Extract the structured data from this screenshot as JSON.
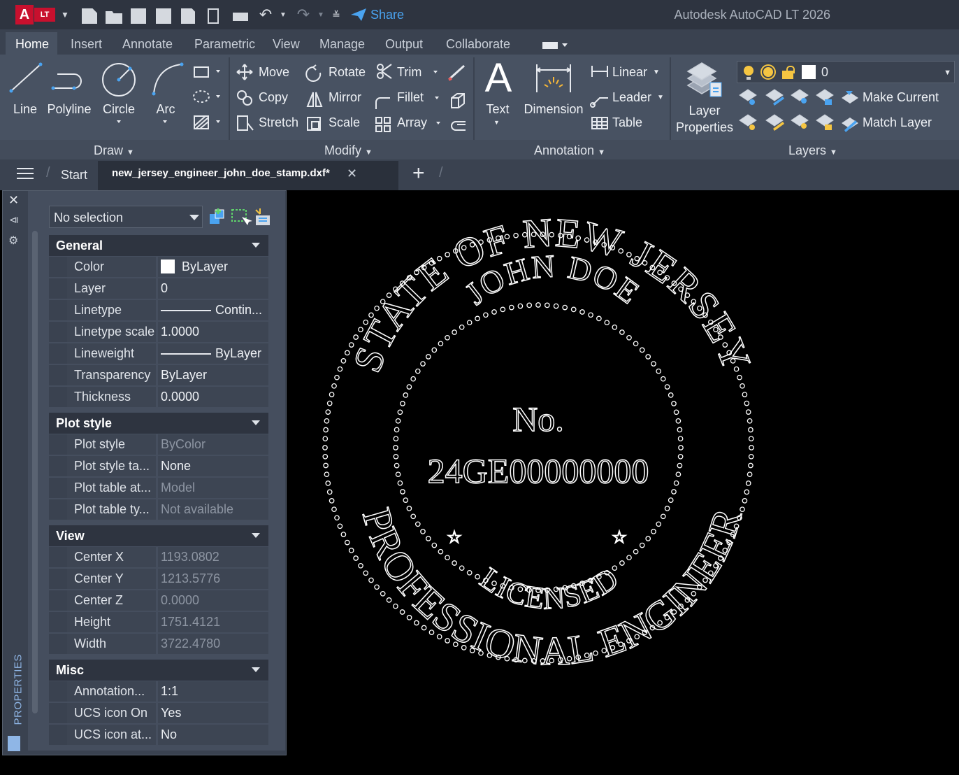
{
  "titlebar": {
    "app_title": "Autodesk AutoCAD LT 2026",
    "app_badge": "LT",
    "share_label": "Share"
  },
  "ribbon_tabs": [
    "Home",
    "Insert",
    "Annotate",
    "Parametric",
    "View",
    "Manage",
    "Output",
    "Collaborate"
  ],
  "draw": {
    "title": "Draw",
    "line": "Line",
    "polyline": "Polyline",
    "circle": "Circle",
    "arc": "Arc"
  },
  "modify": {
    "title": "Modify",
    "move": "Move",
    "rotate": "Rotate",
    "trim": "Trim",
    "copy": "Copy",
    "mirror": "Mirror",
    "fillet": "Fillet",
    "stretch": "Stretch",
    "scale": "Scale",
    "array": "Array"
  },
  "annotation": {
    "title": "Annotation",
    "text": "Text",
    "dimension": "Dimension",
    "linear": "Linear",
    "leader": "Leader",
    "table": "Table"
  },
  "layers": {
    "title": "Layers",
    "layer_properties_1": "Layer",
    "layer_properties_2": "Properties",
    "current_layer": "0",
    "make_current": "Make Current",
    "match_layer": "Match Layer"
  },
  "doctabs": {
    "start": "Start",
    "file": "new_jersey_engineer_john_doe_stamp.dxf*"
  },
  "properties": {
    "palette_label": "PROPERTIES",
    "selection": "No selection",
    "general": {
      "title": "General",
      "rows": [
        {
          "name": "Color",
          "value": "ByLayer"
        },
        {
          "name": "Layer",
          "value": "0"
        },
        {
          "name": "Linetype",
          "value": "Contin..."
        },
        {
          "name": "Linetype scale",
          "value": "1.0000"
        },
        {
          "name": "Lineweight",
          "value": "ByLayer"
        },
        {
          "name": "Transparency",
          "value": "ByLayer"
        },
        {
          "name": "Thickness",
          "value": "0.0000"
        }
      ]
    },
    "plot_style": {
      "title": "Plot style",
      "rows": [
        {
          "name": "Plot style",
          "value": "ByColor"
        },
        {
          "name": "Plot style ta...",
          "value": "None"
        },
        {
          "name": "Plot table at...",
          "value": "Model"
        },
        {
          "name": "Plot table ty...",
          "value": "Not available"
        }
      ]
    },
    "view": {
      "title": "View",
      "rows": [
        {
          "name": "Center X",
          "value": "1193.0802"
        },
        {
          "name": "Center Y",
          "value": "1213.5776"
        },
        {
          "name": "Center Z",
          "value": "0.0000"
        },
        {
          "name": "Height",
          "value": "1751.4121"
        },
        {
          "name": "Width",
          "value": "3722.4780"
        }
      ]
    },
    "misc": {
      "title": "Misc",
      "rows": [
        {
          "name": "Annotation...",
          "value": "1:1"
        },
        {
          "name": "UCS icon On",
          "value": "Yes"
        },
        {
          "name": "UCS icon at...",
          "value": "No"
        }
      ]
    }
  },
  "stamp": {
    "top_outer": "STATE OF NEW JERSEY",
    "top_inner": "JOHN DOE",
    "no_label": "No.",
    "license_number": "24GE00000000",
    "bottom_inner": "LICENSED",
    "bottom_outer": "PROFESSIONAL ENGINEER",
    "star": "☆"
  },
  "colors": {
    "titlebar": "#2e3440",
    "ribbon": "#485262",
    "accent_blue": "#4aa3f0",
    "badge_red": "#c8102e"
  }
}
